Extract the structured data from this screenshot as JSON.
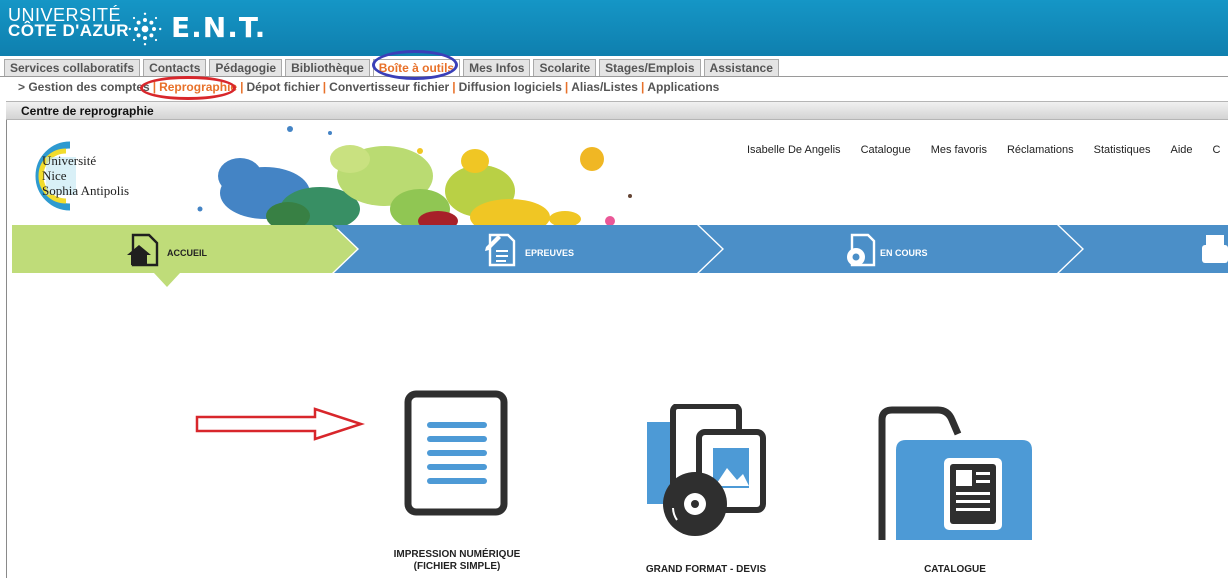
{
  "header": {
    "university_line1": "UNIVERSITÉ",
    "university_line2": "CÔTE D'AZUR",
    "portal_title": "E.N.T."
  },
  "tabs": [
    {
      "label": "Services collaboratifs",
      "active": false
    },
    {
      "label": "Contacts",
      "active": false
    },
    {
      "label": "Pédagogie",
      "active": false
    },
    {
      "label": "Bibliothèque",
      "active": false
    },
    {
      "label": "Boîte à outils",
      "active": true
    },
    {
      "label": "Mes Infos",
      "active": false
    },
    {
      "label": "Scolarite",
      "active": false
    },
    {
      "label": "Stages/Emplois",
      "active": false
    },
    {
      "label": "Assistance",
      "active": false
    }
  ],
  "subnav": {
    "prefix": "> Gestion des comptes",
    "items": [
      "Reprographie",
      "Dépot fichier",
      "Convertisseur fichier",
      "Diffusion logiciels",
      "Alias/Listes",
      "Applications"
    ],
    "active": "Reprographie"
  },
  "section_title": "Centre de reprographie",
  "logo": {
    "line1": "Université",
    "line2": "Nice",
    "line3": "Sophia Antipolis"
  },
  "top_menu": [
    "Isabelle De Angelis",
    "Catalogue",
    "Mes favoris",
    "Réclamations",
    "Statistiques",
    "Aide",
    "C"
  ],
  "steps": [
    {
      "label": "ACCUEIL",
      "icon": "home-document-icon",
      "active": true
    },
    {
      "label": "EPREUVES",
      "icon": "edit-document-icon",
      "active": false
    },
    {
      "label": "EN COURS",
      "icon": "gear-document-icon",
      "active": false
    },
    {
      "label": "",
      "icon": "printer-icon",
      "active": false
    }
  ],
  "tiles": [
    {
      "line1": "IMPRESSION NUMÉRIQUE",
      "line2": "(FICHIER SIMPLE)",
      "icon": "document-icon"
    },
    {
      "line1": "GRAND FORMAT - DEVIS",
      "line2": "",
      "icon": "image-disc-icon"
    },
    {
      "line1": "CATALOGUE",
      "line2": "",
      "icon": "folder-document-icon"
    }
  ],
  "colors": {
    "header_blue": "#1596c6",
    "active_tab_orange": "#e8712a",
    "step_green": "#bfdc79",
    "step_blue": "#4b8fc8",
    "icon_dark": "#2f2f2f",
    "icon_blue": "#4d9ad6",
    "annotation_red": "#d8262b",
    "annotation_blue": "#3a3fb8"
  }
}
